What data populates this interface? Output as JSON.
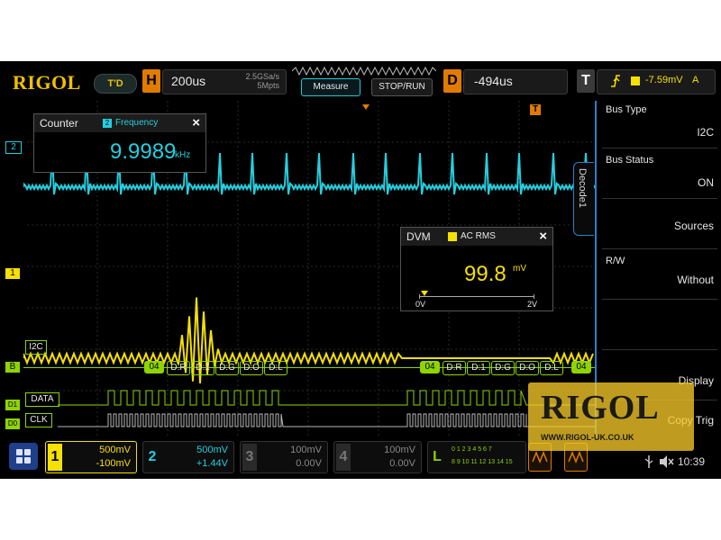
{
  "top": {
    "brand": "RIGOL",
    "mode_badge": "T'D",
    "horizontal": {
      "tag": "H",
      "timebase": "200us",
      "sample_rate": "2.5GSa/s",
      "memory_depth": "5Mpts"
    },
    "measure_label": "Measure",
    "run_label": "STOP/RUN",
    "delay": {
      "tag": "D",
      "value": "-494us"
    },
    "trigger": {
      "tag": "T",
      "level": "-7.59mV",
      "channel": "A"
    }
  },
  "counter": {
    "title": "Counter",
    "channel_mark": "2",
    "mode": "Frequency",
    "value": "9.9989",
    "unit": "kHz",
    "close": "×"
  },
  "dvm": {
    "title": "DVM",
    "mode": "AC RMS",
    "value": "99.8",
    "unit": "mV",
    "scale_min": "0V",
    "scale_max": "2V",
    "close": "×",
    "level_fraction": 0.05
  },
  "right_panel": {
    "tab": "Decode1",
    "items": [
      {
        "label": "Bus Type",
        "value": "I2C"
      },
      {
        "label": "Bus Status",
        "value": "ON"
      },
      {
        "label": "",
        "value": "Sources"
      },
      {
        "label": "R/W",
        "value": "Without"
      },
      {
        "label": "",
        "value": "Display"
      },
      {
        "label": "",
        "value": "Copy Trig"
      }
    ]
  },
  "markers": {
    "ch2": "2",
    "ch1": "1",
    "bus": "B",
    "d1": "D1",
    "d0": "D0",
    "trig_flag": "T"
  },
  "bus": {
    "label": "I2C",
    "packet1": [
      "04",
      "D:R",
      "D:1",
      "D:G",
      "D:O",
      "D:L"
    ],
    "packet2": [
      "04",
      "D:R",
      "D:1",
      "D:G",
      "D:O",
      "D:L"
    ],
    "trailing": "04"
  },
  "digital": {
    "data_label": "DATA",
    "clk_label": "CLK"
  },
  "channels": [
    {
      "num": "1",
      "scale": "500mV",
      "offset": "-100mV",
      "color": "#f5e000",
      "active": true
    },
    {
      "num": "2",
      "scale": "500mV",
      "offset": "+1.44V",
      "color": "#22d0e0",
      "active": true
    },
    {
      "num": "3",
      "scale": "100mV",
      "offset": "0.00V",
      "color": "#666666",
      "active": false
    },
    {
      "num": "4",
      "scale": "100mV",
      "offset": "0.00V",
      "color": "#666666",
      "active": false
    }
  ],
  "logic": {
    "tag": "L",
    "row1": "0 1 2 3   4 5 6 7",
    "row2": "8 9 10 11 12 13 14 15"
  },
  "status": {
    "time": "10:39"
  },
  "watermark": {
    "logo": "RIGOL",
    "url": "WWW.RIGOL-UK.CO.UK"
  },
  "colors": {
    "ch1": "#f5e000",
    "ch2": "#22d0e0",
    "bus": "#8fd400",
    "accent": "#e07b00",
    "panel": "#2a7fc8"
  }
}
